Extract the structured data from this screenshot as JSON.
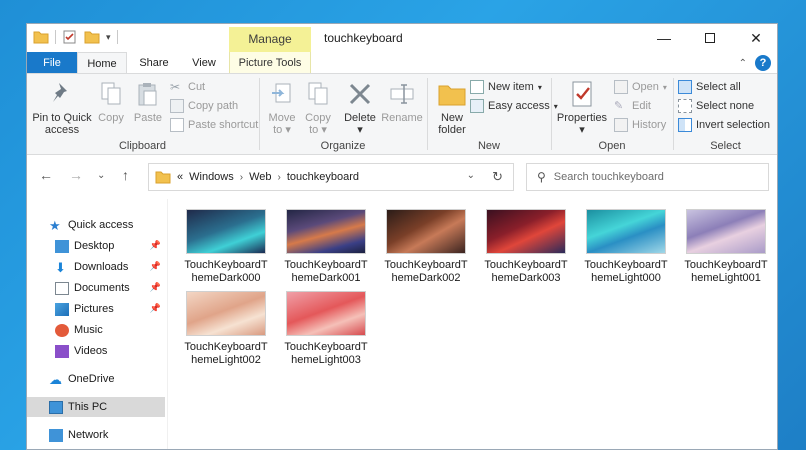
{
  "window": {
    "title": "touchkeyboard",
    "manage_tab": "Manage"
  },
  "tabs": {
    "file": "File",
    "home": "Home",
    "share": "Share",
    "view": "View",
    "picture_tools": "Picture Tools"
  },
  "ribbon": {
    "clipboard": {
      "label": "Clipboard",
      "pin_line1": "Pin to Quick",
      "pin_line2": "access",
      "copy": "Copy",
      "paste": "Paste",
      "cut": "Cut",
      "copy_path": "Copy path",
      "paste_shortcut": "Paste shortcut"
    },
    "organize": {
      "label": "Organize",
      "move_to_line1": "Move",
      "move_to_line2": "to",
      "copy_to_line1": "Copy",
      "copy_to_line2": "to",
      "delete": "Delete",
      "rename": "Rename"
    },
    "new": {
      "label": "New",
      "new_folder_line1": "New",
      "new_folder_line2": "folder",
      "new_item": "New item",
      "easy_access": "Easy access"
    },
    "open": {
      "label": "Open",
      "properties": "Properties",
      "open": "Open",
      "edit": "Edit",
      "history": "History"
    },
    "select": {
      "label": "Select",
      "select_all": "Select all",
      "select_none": "Select none",
      "invert_selection": "Invert selection"
    }
  },
  "address": {
    "overflow": "«",
    "crumbs": [
      "Windows",
      "Web",
      "touchkeyboard"
    ],
    "search_placeholder": "Search touchkeyboard"
  },
  "navpane": {
    "quick_access": "Quick access",
    "desktop": "Desktop",
    "downloads": "Downloads",
    "documents": "Documents",
    "pictures": "Pictures",
    "music": "Music",
    "videos": "Videos",
    "onedrive": "OneDrive",
    "this_pc": "This PC",
    "network": "Network"
  },
  "files": [
    {
      "line1": "TouchKeyboardT",
      "line2": "hemeDark000"
    },
    {
      "line1": "TouchKeyboardT",
      "line2": "hemeDark001"
    },
    {
      "line1": "TouchKeyboardT",
      "line2": "hemeDark002"
    },
    {
      "line1": "TouchKeyboardT",
      "line2": "hemeDark003"
    },
    {
      "line1": "TouchKeyboardT",
      "line2": "hemeLight000"
    },
    {
      "line1": "TouchKeyboardT",
      "line2": "hemeLight001"
    },
    {
      "line1": "TouchKeyboardT",
      "line2": "hemeLight002"
    },
    {
      "line1": "TouchKeyboardT",
      "line2": "hemeLight003"
    }
  ],
  "colors": {
    "accent": "#1979ca",
    "manage": "#f4f196",
    "selected_nav": "#d9d9d9"
  }
}
